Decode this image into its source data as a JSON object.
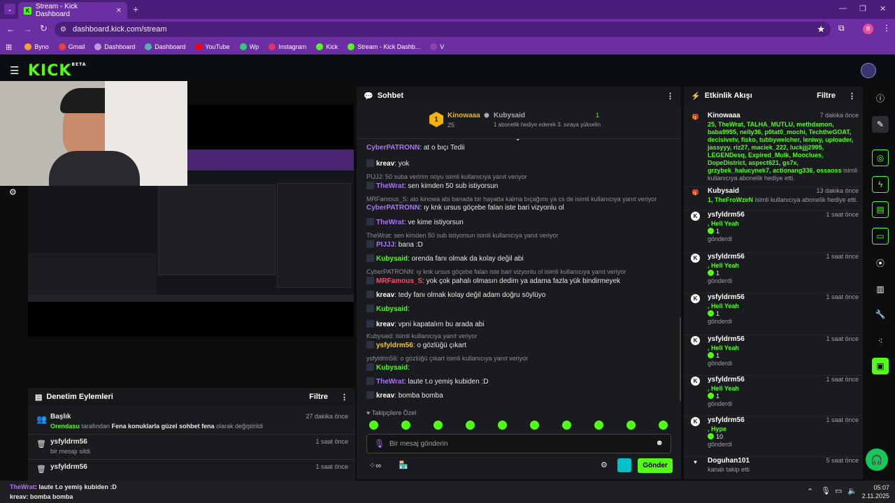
{
  "browser": {
    "tab_title": "Stream - Kick Dashboard",
    "url": "dashboard.kick.com/stream",
    "bookmarks": [
      {
        "label": "Byno",
        "color": "#f4a623"
      },
      {
        "label": "Gmail",
        "color": "#ea4335"
      },
      {
        "label": "Dashboard",
        "color": "#b39ddb"
      },
      {
        "label": "Dashboard",
        "color": "#4db6ac"
      },
      {
        "label": "YouTube",
        "color": "#ff0000"
      },
      {
        "label": "Wp",
        "color": "#25d366"
      },
      {
        "label": "Instagram",
        "color": "#e1306c"
      },
      {
        "label": "Kick",
        "color": "#53fc18"
      },
      {
        "label": "Stream - Kick Dashb...",
        "color": "#53fc18"
      },
      {
        "label": "V",
        "color": "#8e44ad"
      }
    ],
    "profile_initial": "B"
  },
  "app": {
    "logo": "KICK",
    "logo_sup": "BETA"
  },
  "chat": {
    "title": "Sohbet",
    "pinned": {
      "rank": "1",
      "user1": "Kinowaaa",
      "user1_count": "25",
      "user2": "Kubysaid",
      "user2_count": "1",
      "message": "1 abonelik hediye ederek 3. sıraya yükselin"
    },
    "messages": [
      {
        "type": "msg",
        "user": "CyberPATRONN",
        "color": "#b072ff",
        "text": ": at o bıçı Tedii"
      },
      {
        "type": "msg",
        "user": "kreav",
        "color": "#ffffff",
        "text": ": yok"
      },
      {
        "type": "reply",
        "text": "PIJJJ: 50 suba veririm noyu isimli kullanıcıya yanıt veriyor"
      },
      {
        "type": "msg",
        "user": "TheWrat",
        "color": "#b072ff",
        "text": ": sen kimden 50 sub istiyorsun"
      },
      {
        "type": "reply",
        "text": "MRFamous_S: alo kinowa abi banada bir hayatta kalma bıçağımı ya cs de isimli kullanıcıya yanıt veriyor"
      },
      {
        "type": "msg",
        "user": "CyberPATRONN",
        "color": "#b072ff",
        "text": ": ıy knk ursus göçebe falan iste bari vizyonlu ol"
      },
      {
        "type": "msg",
        "user": "TheWrat",
        "color": "#b072ff",
        "text": ": ve kime istiyorsun"
      },
      {
        "type": "reply",
        "text": "TheWrat: sen kimden 50 sub istiyorsun isimli kullanıcıya yanıt veriyor"
      },
      {
        "type": "msg",
        "user": "PIJJJ",
        "color": "#b072ff",
        "text": ": bana :D"
      },
      {
        "type": "msg",
        "user": "Kubysaid",
        "color": "#53fc18",
        "text": ": orenda fanı olmak da kolay değil abi"
      },
      {
        "type": "reply",
        "text": "CyberPATRONN: ıy knk ursus göçebe falan iste bari vizyonlu ol isimli kullanıcıya yanıt veriyor"
      },
      {
        "type": "msg",
        "user": "MRFamous_S",
        "color": "#ff4d6d",
        "text": ": yok çok pahalı olmasın dedim ya adama fazla yük bindirmeyek"
      },
      {
        "type": "msg",
        "user": "kreav",
        "color": "#ffffff",
        "text": ": tedy fanı olmak kolay değil adam doğru söylüyo"
      },
      {
        "type": "msg",
        "user": "Kubysaid",
        "color": "#53fc18",
        "text": ":"
      },
      {
        "type": "msg",
        "user": "kreav",
        "color": "#ffffff",
        "text": ": vpni kapatalım bu arada abi"
      },
      {
        "type": "reply",
        "text": "Kubysaid: isimli kullanıcıya yanıt veriyor"
      },
      {
        "type": "msg",
        "user": "ysfyldrm56",
        "color": "#f4c430",
        "text": ": o gözlüğü çıkart"
      },
      {
        "type": "reply",
        "text": "ysfyldrm56: o gözlüğü çıkart isimli kullanıcıya yanıt veriyor"
      },
      {
        "type": "msg",
        "user": "Kubysaid",
        "color": "#53fc18",
        "text": ":"
      },
      {
        "type": "msg",
        "user": "TheWrat",
        "color": "#b072ff",
        "text": ": laute t.o yemiş kubiden :D"
      },
      {
        "type": "msg",
        "user": "kreav",
        "color": "#ffffff",
        "text": ": bomba bomba"
      }
    ],
    "followers_only": "Takipçilere Özel",
    "input_placeholder": "Bir mesaj gönderin",
    "send_label": "Gönder"
  },
  "activity": {
    "title": "Etkinlik Akışı",
    "filter": "Filtre",
    "items": [
      {
        "icon": "gift-icon",
        "user": "Kinowaaa",
        "time": "7 dakika önce",
        "highlight": "25, TheWrat, TALHA_MUTLU, methdamon, baba9955, nelly36, p0tat0_mochi, TechtheGOAT, decisivetv, fisko, tubbywelcher, leniwy, uploader, jassyyy, riz27, maciek_222, luckjjj2995, LEGENDesq, Expired_Mulk, Mooclues, DopeDistrict, aspect621, gs7x, grzybek_halucynek7, actionang336, ossaoss",
        "text": "isimli kullanıcıya abonelik hediye etti."
      },
      {
        "icon": "gift-icon",
        "user": "Kubysaid",
        "time": "13 dakika önce",
        "highlight": "1, TheFroWzeN",
        "text": "isimli kullanıcıya abonelik hediye etti."
      },
      {
        "icon": "kick-coin-icon",
        "user": "ysfyldrm56",
        "time": "1 saat önce",
        "highlight": ", Hell Yeah",
        "amount": "1",
        "text": "gönderdi"
      },
      {
        "icon": "kick-coin-icon",
        "user": "ysfyldrm56",
        "time": "1 saat önce",
        "highlight": ", Hell Yeah",
        "amount": "1",
        "text": "gönderdi"
      },
      {
        "icon": "kick-coin-icon",
        "user": "ysfyldrm56",
        "time": "1 saat önce",
        "highlight": ", Hell Yeah",
        "amount": "1",
        "text": "gönderdi"
      },
      {
        "icon": "kick-coin-icon",
        "user": "ysfyldrm56",
        "time": "1 saat önce",
        "highlight": ", Hell Yeah",
        "amount": "1",
        "text": "gönderdi"
      },
      {
        "icon": "kick-coin-icon",
        "user": "ysfyldrm56",
        "time": "1 saat önce",
        "highlight": ", Hell Yeah",
        "amount": "1",
        "text": "gönderdi"
      },
      {
        "icon": "kick-coin-icon",
        "user": "ysfyldrm56",
        "time": "1 saat önce",
        "highlight": ", Hype",
        "amount": "10",
        "text": "gönderdi"
      },
      {
        "icon": "heart-icon",
        "user": "Doguhan101",
        "time": "5 saat önce",
        "highlight": "",
        "text": "kanalı takip etti"
      }
    ]
  },
  "moderation": {
    "title": "Denetim Eylemleri",
    "filter": "Filtre",
    "items": [
      {
        "title": "Başlık",
        "time": "27 dakika önce",
        "actor": "Orendasu",
        "mid1": "tarafından",
        "value": "Fena konuklarla güzel sohbet fena",
        "mid2": "olarak değiştirildi"
      },
      {
        "title": "ysfyldrm56",
        "time": "1 saat önce",
        "text": "bir mesajı sildi"
      },
      {
        "title": "ysfyldrm56",
        "time": "1 saat önce",
        "text": ""
      }
    ]
  },
  "taskbar": {
    "overlay_line1_user": "TheWrat",
    "overlay_line1_text": ": laute t.o yemiş kubiden :D",
    "overlay_line2_user": "kreav",
    "overlay_line2_text": ": bomba bomba",
    "time": "05:07",
    "date": "2.11.2025"
  }
}
